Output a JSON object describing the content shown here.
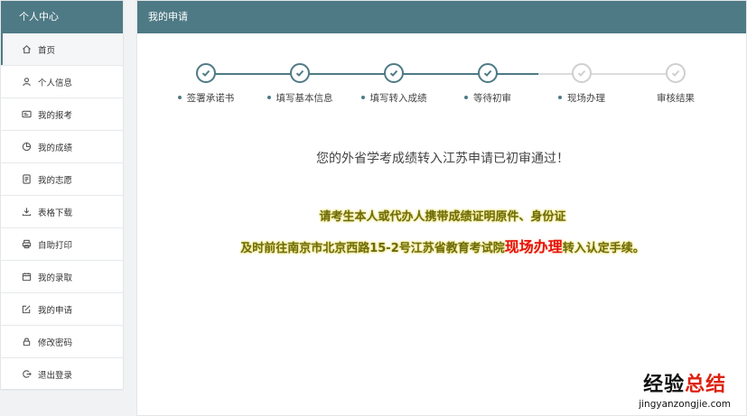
{
  "sidebar": {
    "title": "个人中心",
    "items": [
      {
        "label": "首页",
        "icon": "home-icon"
      },
      {
        "label": "个人信息",
        "icon": "user-icon"
      },
      {
        "label": "我的报考",
        "icon": "id-card-icon"
      },
      {
        "label": "我的成绩",
        "icon": "pie-chart-icon"
      },
      {
        "label": "我的志愿",
        "icon": "document-icon"
      },
      {
        "label": "表格下载",
        "icon": "download-icon"
      },
      {
        "label": "自助打印",
        "icon": "printer-icon"
      },
      {
        "label": "我的录取",
        "icon": "calendar-icon"
      },
      {
        "label": "我的申请",
        "icon": "edit-icon"
      },
      {
        "label": "修改密码",
        "icon": "lock-icon"
      },
      {
        "label": "退出登录",
        "icon": "logout-icon"
      }
    ]
  },
  "main": {
    "title": "我的申请",
    "steps": [
      {
        "label": "签署承诺书",
        "done": true
      },
      {
        "label": "填写基本信息",
        "done": true
      },
      {
        "label": "填写转入成绩",
        "done": true
      },
      {
        "label": "等待初审",
        "done": true
      },
      {
        "label": "现场办理",
        "done": false
      },
      {
        "label": "审核结果",
        "done": false
      }
    ],
    "message": "您的外省学考成绩转入江苏申请已初审通过！",
    "notice_line1": "请考生本人或代办人携带成绩证明原件、身份证",
    "notice_line2_prefix": "及时前往南京市北京西路15-2号江苏省教育考试院",
    "notice_line2_highlight": "现场办理",
    "notice_line2_suffix": "转入认定手续。"
  },
  "watermark": {
    "text_part1": "经验",
    "text_part2": "总结",
    "url": "jingyanzongjie.com"
  },
  "colors": {
    "primary": "#4e7a85",
    "highlight": "#e8120c",
    "notice_text": "#6b6b12",
    "inactive": "#cfcfcf"
  }
}
